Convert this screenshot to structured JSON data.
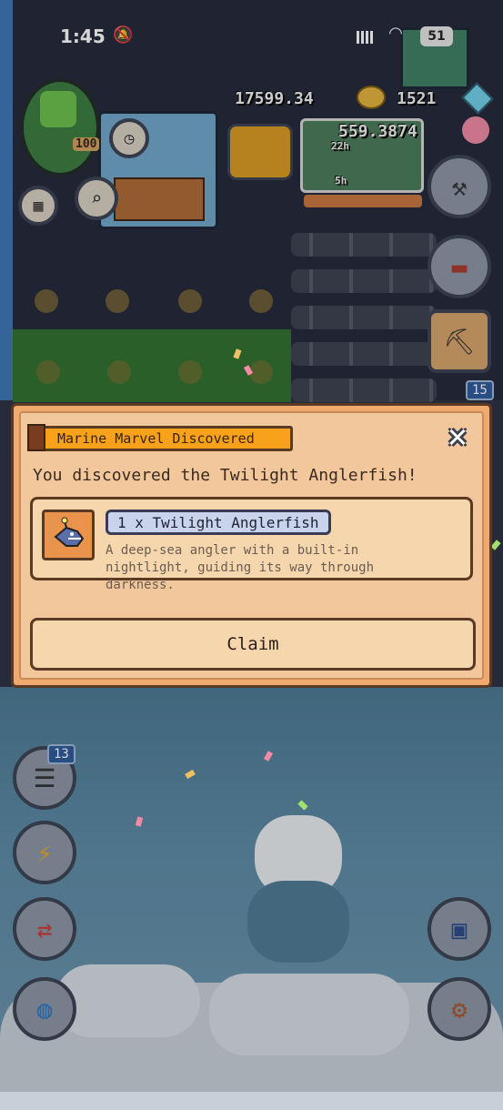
{
  "status_bar": {
    "time": "1:45",
    "battery": "51"
  },
  "hud": {
    "gold": "17599.34",
    "gems": "1521",
    "secondary_currency": "559.3874",
    "player_level": "100",
    "timer_22h": "22h",
    "timer_5h": "5h",
    "inventory_count": "15"
  },
  "dialog": {
    "title": "Marine Marvel Discovered",
    "headline": "You discovered the Twilight Anglerfish!",
    "item": {
      "name": "1 x Twilight Anglerfish",
      "description": "A deep-sea angler with a built-in nightlight, guiding its way through darkness."
    },
    "claim_label": "Claim",
    "close_symbol": "✕"
  },
  "side_menu": {
    "chat_badge": "13",
    "icons": {
      "chat": "chat-icon",
      "energy": "lightning-icon",
      "trade": "swap-icon",
      "world": "globe-icon",
      "save": "floppy-icon",
      "settings": "gear-icon",
      "build": "hammer-icon",
      "chest": "chest-icon",
      "crafting": "crafting-icon",
      "calendar": "calendar-icon",
      "search": "magnifier-icon"
    }
  },
  "colors": {
    "dialog_bg": "#f0a96e",
    "title_bar": "#f8a21c",
    "card_bg": "#f5d6ad",
    "border": "#5b3a23",
    "name_pill": "#c9d4ec"
  }
}
